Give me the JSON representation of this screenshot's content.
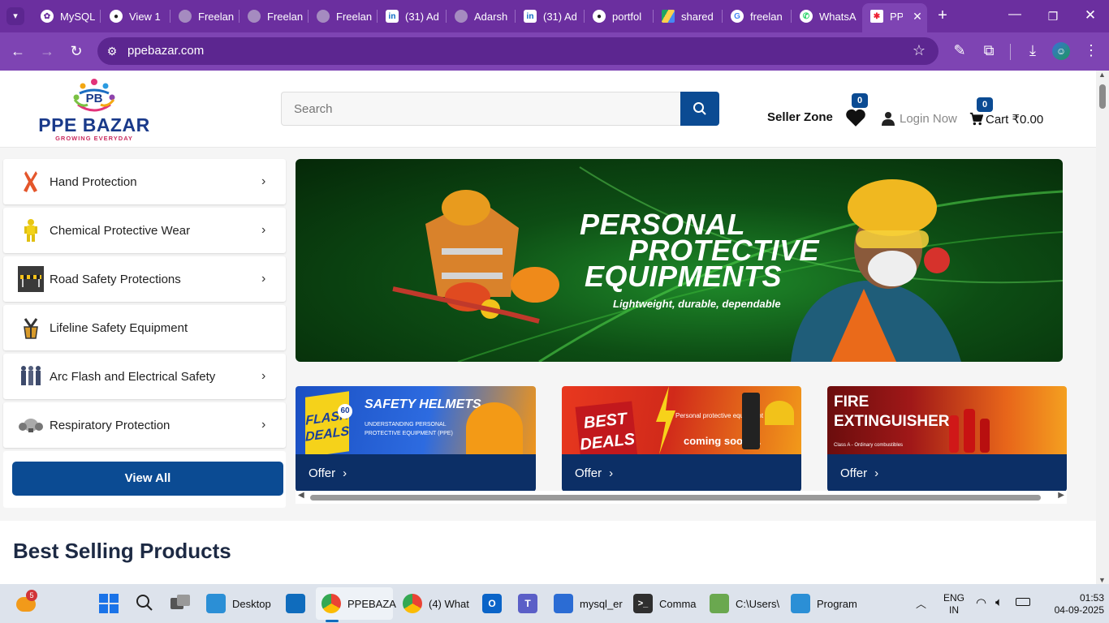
{
  "browser": {
    "tabs": [
      {
        "label": "MySQL",
        "icon": "mysql-icon"
      },
      {
        "label": "View 1",
        "icon": "github-icon"
      },
      {
        "label": "Freelan",
        "icon": "globe-icon"
      },
      {
        "label": "Freelan",
        "icon": "globe-icon"
      },
      {
        "label": "Freelan",
        "icon": "globe-icon"
      },
      {
        "label": "(31) Ad",
        "icon": "linkedin-icon"
      },
      {
        "label": "Adarsh",
        "icon": "globe-icon"
      },
      {
        "label": "(31) Ad",
        "icon": "linkedin-icon"
      },
      {
        "label": "portfol",
        "icon": "github-icon"
      },
      {
        "label": "shared",
        "icon": "drive-icon"
      },
      {
        "label": "freelan",
        "icon": "google-icon"
      },
      {
        "label": "WhatsA",
        "icon": "whatsapp-icon"
      },
      {
        "label": "PP",
        "icon": "ppe-favicon"
      }
    ],
    "url": "ppebazar.com",
    "theme_color": "#6b2f9f"
  },
  "site": {
    "logo_text": "PPE BAZAR",
    "logo_tagline": "GROWING EVERYDAY",
    "logo_mark": "PB",
    "search_placeholder": "Search",
    "seller_zone": "Seller Zone",
    "wishlist_count": "0",
    "login": "Login Now",
    "cart_count": "0",
    "cart_label": "Cart ₹0.00",
    "brand_color": "#0b4b93"
  },
  "categories": [
    {
      "label": "Hand Protection",
      "icon": "glove-icon",
      "chevron": "›"
    },
    {
      "label": "Chemical Protective Wear",
      "icon": "hazmat-suit-icon",
      "chevron": "›"
    },
    {
      "label": "Road Safety Protections",
      "icon": "road-barrier-icon",
      "chevron": "›"
    },
    {
      "label": "Lifeline Safety Equipment",
      "icon": "harness-icon",
      "chevron": ""
    },
    {
      "label": "Arc Flash and Electrical Safety",
      "icon": "arc-suit-icon",
      "chevron": "›"
    },
    {
      "label": "Respiratory Protection",
      "icon": "respirator-icon",
      "chevron": "›"
    }
  ],
  "view_all": "View All",
  "banner": {
    "line1": "PERSONAL",
    "line2": "PROTECTIVE",
    "line3": "EQUIPMENTS",
    "tagline": "Lightweight, durable, dependable"
  },
  "offers": [
    {
      "label": "Offer",
      "art_title": "SAFETY HELMETS",
      "art_sub": "UNDERSTANDING PERSONAL PROTECTIVE EQUIPMENT (PPE)",
      "art_badge": "FLASH DEALS",
      "art_badge_num": "60"
    },
    {
      "label": "Offer",
      "art_title": "BEST DEALS",
      "art_sub": "Personal protective equipment",
      "art_badge": "coming soon....",
      "art_badge_num": ""
    },
    {
      "label": "Offer",
      "art_title": "FIRE EXTINGUISHER",
      "art_sub": "Class A - Ordinary combustibles",
      "art_badge": "",
      "art_badge_num": ""
    }
  ],
  "section_title": "Best Selling Products",
  "taskbar": {
    "notification_count": "5",
    "items": [
      {
        "label": "Desktop",
        "icon": "desktop-icon"
      },
      {
        "label": "PPEBAZA",
        "icon": "chrome-icon"
      },
      {
        "label": "(4) What",
        "icon": "chrome-icon"
      },
      {
        "label": "mysql_er",
        "icon": "notepad-icon"
      },
      {
        "label": "Comma",
        "icon": "terminal-icon"
      },
      {
        "label": "C:\\Users\\",
        "icon": "editor-icon"
      },
      {
        "label": "Program",
        "icon": "program-icon"
      }
    ],
    "lang": "ENG",
    "region": "IN",
    "time": "01:53",
    "date": "04-09-2025"
  }
}
